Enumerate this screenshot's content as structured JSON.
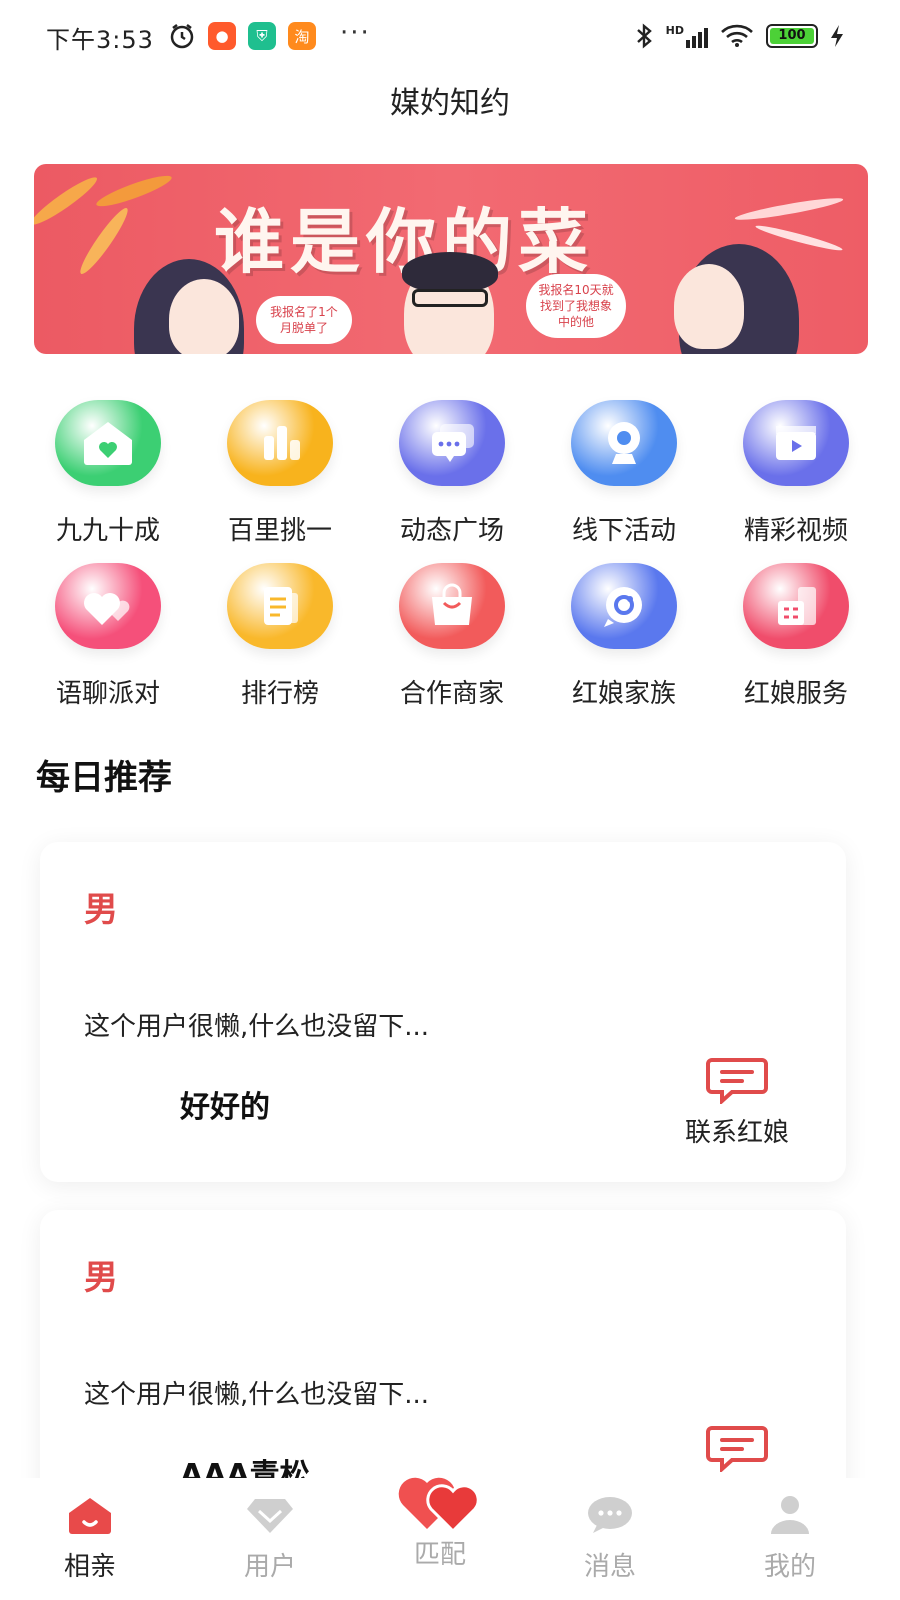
{
  "status_bar": {
    "time": "下午3:53",
    "dots": "···",
    "network": "HD",
    "battery": "100"
  },
  "app": {
    "title": "媒妁知约"
  },
  "banner": {
    "title": "谁是你的菜",
    "bubble_left": "我报名了1个月脱单了",
    "bubble_right": "我报名10天就找到了我想象中的他"
  },
  "features": [
    {
      "label": "九九十成",
      "icon": "house-heart-icon",
      "color": "#3ccf73"
    },
    {
      "label": "百里挑一",
      "icon": "bar-chart-icon",
      "color": "#f8b31d"
    },
    {
      "label": "动态广场",
      "icon": "chat-bubbles-icon",
      "color": "#6a70ea"
    },
    {
      "label": "线下活动",
      "icon": "webcam-icon",
      "color": "#4f8df0"
    },
    {
      "label": "精彩视频",
      "icon": "video-clapper-icon",
      "color": "#6a70ea"
    },
    {
      "label": "语聊派对",
      "icon": "hearts-icon",
      "color": "#f5507a"
    },
    {
      "label": "排行榜",
      "icon": "document-icon",
      "color": "#f9b82b"
    },
    {
      "label": "合作商家",
      "icon": "shopping-bag-icon",
      "color": "#f25b5b"
    },
    {
      "label": "红娘家族",
      "icon": "chat-circle-icon",
      "color": "#5a78ee"
    },
    {
      "label": "红娘服务",
      "icon": "building-icon",
      "color": "#f04d6b"
    }
  ],
  "recommend": {
    "title": "每日推荐",
    "cards": [
      {
        "gender": "男",
        "desc": "这个用户很懒,什么也没留下...",
        "name": "好好的",
        "contact_label": "联系红娘"
      },
      {
        "gender": "男",
        "desc": "这个用户很懒,什么也没留下...",
        "name": "AAA青松",
        "contact_label": ""
      }
    ]
  },
  "tabbar": [
    {
      "label": "相亲",
      "icon": "home-icon",
      "active": true
    },
    {
      "label": "用户",
      "icon": "diamond-icon",
      "active": false
    },
    {
      "label": "匹配",
      "icon": "double-heart-icon",
      "active": false
    },
    {
      "label": "消息",
      "icon": "message-icon",
      "active": false
    },
    {
      "label": "我的",
      "icon": "profile-icon",
      "active": false
    }
  ],
  "colors": {
    "accent": "#e04b4b",
    "banner": "#ee5d66",
    "tab_active": "#e84a4a",
    "tab_inactive": "#c8c8c8"
  }
}
